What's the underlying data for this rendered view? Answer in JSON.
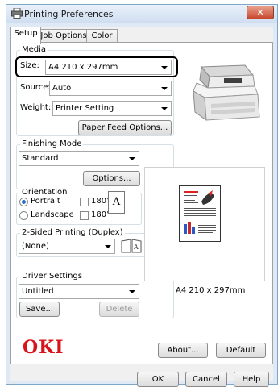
{
  "window": {
    "title": "Printing Preferences",
    "close_glyph": "✕"
  },
  "tabs": [
    {
      "label": "Setup",
      "active": true
    },
    {
      "label": "Job Options",
      "active": false
    },
    {
      "label": "Color",
      "active": false
    }
  ],
  "media": {
    "group_label": "Media",
    "size_label": "Size:",
    "size_value": "A4 210 x 297mm",
    "source_label": "Source:",
    "source_value": "Auto",
    "weight_label": "Weight:",
    "weight_value": "Printer Setting",
    "paper_feed_button": "Paper Feed Options..."
  },
  "finishing": {
    "group_label": "Finishing Mode",
    "value": "Standard",
    "options_button": "Options..."
  },
  "orientation": {
    "group_label": "Orientation",
    "portrait": "Portrait",
    "landscape": "Landscape",
    "rotate_180_a": "180°",
    "rotate_180_b": "180°",
    "selected": "Portrait",
    "page_glyph": "A"
  },
  "duplex": {
    "group_label": "2-Sided Printing (Duplex)",
    "value": "(None)"
  },
  "driver_settings": {
    "group_label": "Driver Settings",
    "value": "Untitled",
    "save_button": "Save...",
    "delete_button": "Delete"
  },
  "preview": {
    "paper_caption": "A4 210 x 297mm"
  },
  "brand": {
    "logo_text": "OKI",
    "logo_color": "#d8141b"
  },
  "bottom_buttons": {
    "about": "About...",
    "default": "Default"
  },
  "dialog_buttons": {
    "ok": "OK",
    "cancel": "Cancel",
    "help": "Help"
  }
}
